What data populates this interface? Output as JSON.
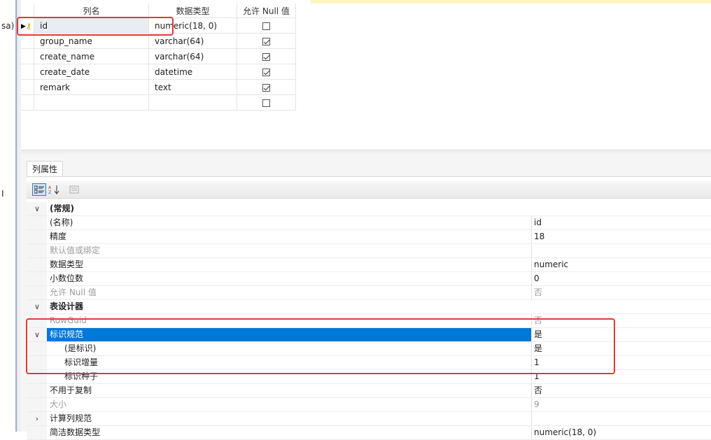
{
  "sidebar": {
    "connection_suffix": "sa)",
    "cursor_mark": "I"
  },
  "columns_grid": {
    "headers": {
      "name": "列名",
      "type": "数据类型",
      "allow_null": "允许 Null 值"
    },
    "rows": [
      {
        "name": "id",
        "type": "numeric(18, 0)",
        "allow_null": false,
        "primary_key": true
      },
      {
        "name": "group_name",
        "type": "varchar(64)",
        "allow_null": true
      },
      {
        "name": "create_name",
        "type": "varchar(64)",
        "allow_null": true
      },
      {
        "name": "create_date",
        "type": "datetime",
        "allow_null": true
      },
      {
        "name": "remark",
        "type": "text",
        "allow_null": true
      },
      {
        "name": "",
        "type": "",
        "allow_null": false
      }
    ]
  },
  "properties_panel": {
    "tab_label": "列属性",
    "toolbar": {
      "categorized": "categorized-icon",
      "alphabetical": "sort-az-icon",
      "pages": "property-pages-icon"
    },
    "rows": [
      {
        "kind": "category",
        "expanded": true,
        "name": "(常规)",
        "value": ""
      },
      {
        "kind": "prop",
        "name": "(名称)",
        "value": "id"
      },
      {
        "kind": "prop",
        "name": "精度",
        "value": "18"
      },
      {
        "kind": "prop",
        "name": "默认值或绑定",
        "value": "",
        "disabled": true
      },
      {
        "kind": "prop",
        "name": "数据类型",
        "value": "numeric"
      },
      {
        "kind": "prop",
        "name": "小数位数",
        "value": "0"
      },
      {
        "kind": "prop",
        "name": "允许 Null 值",
        "value": "否",
        "disabled": true
      },
      {
        "kind": "category",
        "expanded": true,
        "name": "表设计器",
        "value": ""
      },
      {
        "kind": "prop",
        "name": "RowGuid",
        "value": "否",
        "disabled": true
      },
      {
        "kind": "prop",
        "name": "标识规范",
        "value": "是",
        "expandable": true,
        "expanded": true,
        "selected": true
      },
      {
        "kind": "sub",
        "name": "(是标识)",
        "value": "是"
      },
      {
        "kind": "sub",
        "name": "标识增量",
        "value": "1"
      },
      {
        "kind": "sub",
        "name": "标识种子",
        "value": "1"
      },
      {
        "kind": "prop",
        "name": "不用于复制",
        "value": "否"
      },
      {
        "kind": "prop",
        "name": "大小",
        "value": "9",
        "disabled": true
      },
      {
        "kind": "prop",
        "name": "计算列规范",
        "value": "",
        "expandable": true,
        "expanded": false
      },
      {
        "kind": "prop",
        "name": "简洁数据类型",
        "value": "numeric(18, 0)"
      }
    ]
  },
  "colors": {
    "selection": "#0078d7",
    "highlight_box": "#e53935",
    "key_icon": "#c9a100"
  }
}
